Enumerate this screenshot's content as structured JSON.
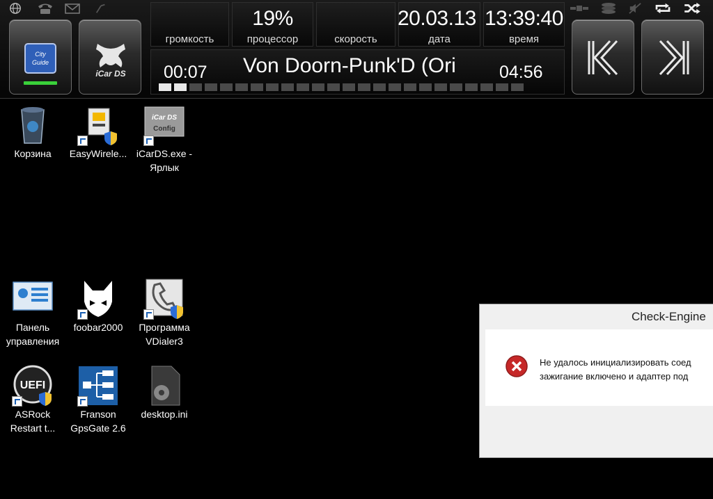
{
  "topbar": {
    "status_icons": [
      "globe-icon",
      "phone-icon",
      "mail-icon",
      "wireless-icon",
      "gps-icon",
      "disk-icon",
      "mute-icon",
      "repeat-icon",
      "shuffle-icon"
    ],
    "apps": [
      {
        "name": "city-guide",
        "label": "City Guide"
      },
      {
        "name": "icar-ds",
        "label": "iCar DS"
      }
    ],
    "volume": {
      "value": "",
      "label": "громкость"
    },
    "cpu": {
      "value": "19%",
      "label": "процессор"
    },
    "speed": {
      "value": "",
      "label": "скорость"
    },
    "date": {
      "value": "20.03.13",
      "label": "дата"
    },
    "time": {
      "value": "13:39:40",
      "label": "время"
    },
    "player": {
      "elapsed": "00:07",
      "track": "Von Doorn-Punk'D (Ori",
      "total": "04:56",
      "progress_segments": 24,
      "progress_filled": 2
    },
    "nav": {
      "prev_icon": "rewind-icon",
      "next_icon": "forward-icon"
    }
  },
  "desktop": {
    "icons": [
      {
        "key": "recycle-bin",
        "label": "Корзина",
        "shortcut": false
      },
      {
        "key": "easywireless",
        "label": "EasyWirele...",
        "shortcut": true
      },
      {
        "key": "icards-shortcut",
        "label": "iCarDS.exe - Ярлык",
        "shortcut": true
      },
      {
        "key": "control-panel",
        "label": "Панель управления",
        "shortcut": false
      },
      {
        "key": "foobar2000",
        "label": "foobar2000",
        "shortcut": true
      },
      {
        "key": "vdialer3",
        "label": "Программа VDialer3",
        "shortcut": true
      },
      {
        "key": "asrock-restart",
        "label": "ASRock Restart t...",
        "shortcut": true
      },
      {
        "key": "franson-gpsgate",
        "label": "Franson GpsGate 2.6",
        "shortcut": true
      },
      {
        "key": "desktop-ini",
        "label": "desktop.ini",
        "shortcut": false
      }
    ]
  },
  "dialog": {
    "title": "Check-Engine",
    "icon": "error-icon",
    "message_line1": "Не удалось инициализировать соед",
    "message_line2": "зажигание включено и адаптер под"
  },
  "colors": {
    "background": "#000000",
    "error_red": "#c62828",
    "dialog_bg": "#f0f0f0"
  }
}
